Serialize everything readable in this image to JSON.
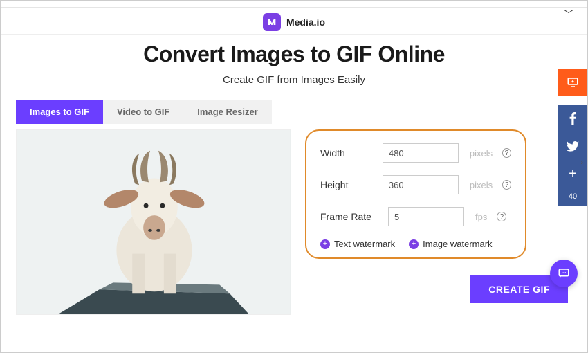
{
  "brand": {
    "name": "Media.io"
  },
  "hero": {
    "title": "Convert Images to GIF Online",
    "subtitle": "Create GIF from Images Easily"
  },
  "tabs": [
    {
      "label": "Images to GIF",
      "active": true
    },
    {
      "label": "Video to GIF",
      "active": false
    },
    {
      "label": "Image Resizer",
      "active": false
    }
  ],
  "settings": {
    "width": {
      "label": "Width",
      "value": "480",
      "unit": "pixels"
    },
    "height": {
      "label": "Height",
      "value": "360",
      "unit": "pixels"
    },
    "frame_rate": {
      "label": "Frame Rate",
      "value": "5",
      "unit": "fps"
    }
  },
  "watermark": {
    "text_label": "Text watermark",
    "image_label": "Image watermark"
  },
  "actions": {
    "create": "CREATE GIF"
  },
  "share_rail": {
    "count": "40"
  }
}
